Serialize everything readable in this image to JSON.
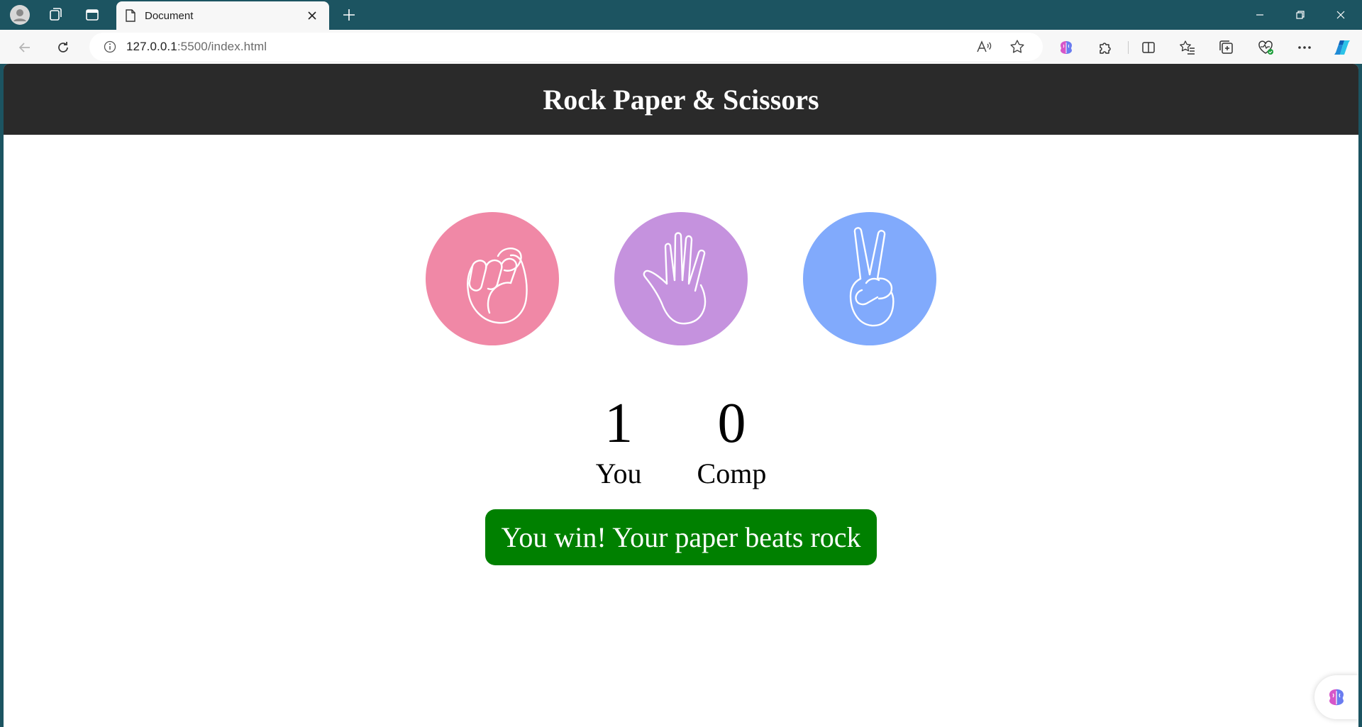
{
  "browser": {
    "tab": {
      "title": "Document"
    },
    "address": {
      "host": "127.0.0.1",
      "rest": ":5500/index.html"
    }
  },
  "page": {
    "title": "Rock Paper & Scissors",
    "choices": [
      {
        "name": "rock",
        "icon": "fist-icon",
        "color": "#f088a6"
      },
      {
        "name": "paper",
        "icon": "open-hand-icon",
        "color": "#c592de"
      },
      {
        "name": "scissors",
        "icon": "peace-hand-icon",
        "color": "#81aafc"
      }
    ],
    "scores": {
      "user": {
        "value": "1",
        "label": "You"
      },
      "comp": {
        "value": "0",
        "label": "Comp"
      }
    },
    "message": {
      "text": "You win! Your paper beats rock",
      "color": "#008000"
    }
  }
}
